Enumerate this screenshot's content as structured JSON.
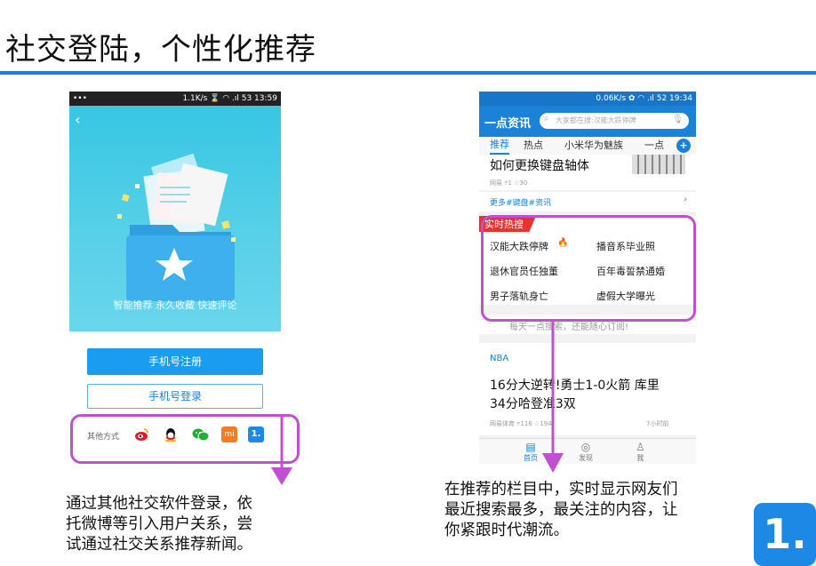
{
  "title": "社交登陆，个性化推荐",
  "left_phone": {
    "status_left": "•••",
    "status_right": "1.1K/s ⌛ ◠ .ıl 53 13:59",
    "back": "‹",
    "tagline": "智能推荐  永久收藏  快速评论",
    "register_button": "手机号注册",
    "login_button": "手机号登录",
    "other_label": "其他方式",
    "social": [
      "weibo",
      "qq",
      "wechat",
      "mi",
      "1."
    ],
    "mi_label": "mi",
    "yidian_label": "1."
  },
  "right_phone": {
    "status_right": "0.06K/s ✿ ◠ .ıl 52 19:34",
    "app_name": "一点资讯",
    "search_placeholder": "大家都在搜:汉能大跌停牌",
    "tabs": [
      "推荐",
      "热点",
      "小米华为魅族",
      "一点"
    ],
    "tab_plus": "+",
    "article1_title": "如何更换键盘轴体",
    "article1_meta_source": "网易",
    "article1_meta_comments": "1",
    "article1_meta_likes": "30",
    "more_link": "更多#键盘#资讯",
    "hot_label": "实时热搜",
    "hot_items": [
      "汉能大跌停牌",
      "播音系毕业照",
      "退休官员任独董",
      "百年毒誓禁通婚",
      "男子落轨身亡",
      "虚假大学曝光"
    ],
    "hot_search_hint": "每天一点搜索，还能随心订阅!",
    "nba_label": "NBA",
    "article2_title_line1": "16分大逆转!勇士1-0火箭 库里",
    "article2_title_line2": "34分哈登准3双",
    "article2_meta_source": "网易体育",
    "article2_meta_comments": "116",
    "article2_meta_likes": "194",
    "article2_time": "7小时前",
    "nav": [
      "首页",
      "发现",
      "我"
    ]
  },
  "caption_left": [
    "通过其他社交软件登录，依",
    "托微博等引入用户关系，尝",
    "试通过社交关系推荐新闻。"
  ],
  "caption_right": [
    "在推荐的栏目中，实时显示网友们",
    "最近搜索最多，最关注的内容，让",
    "你紧跟时代潮流。"
  ],
  "corner_logo": "1.",
  "colors": {
    "accent": "#1e7fd6",
    "highlight": "#c24fd0",
    "hot_red": "#e8322d"
  }
}
